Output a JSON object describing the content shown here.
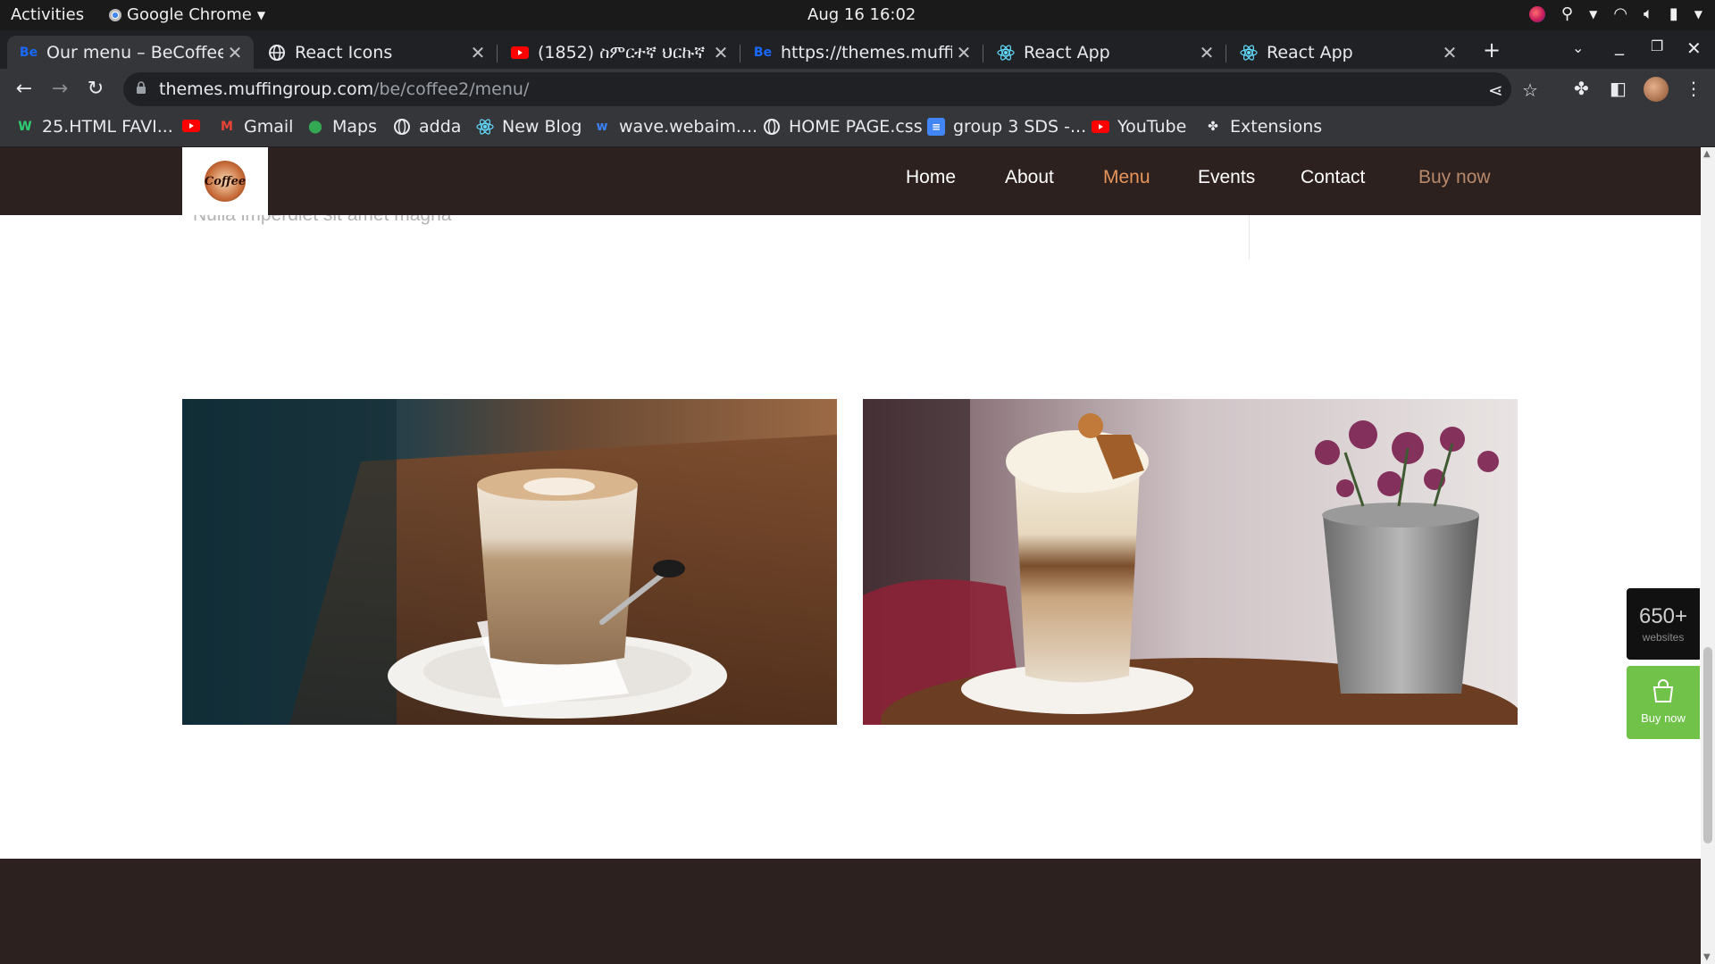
{
  "os_bar": {
    "activities": "Activities",
    "app_name": "Google Chrome",
    "clock": "Aug 16  16:02"
  },
  "tabs": [
    {
      "label": "Our menu – BeCoffee",
      "favicon": "Be",
      "active": true
    },
    {
      "label": "React Icons",
      "favicon": "globe-icon"
    },
    {
      "label": "(1852) ስምርተኛ ህርኩኛ",
      "favicon": "youtube-icon"
    },
    {
      "label": "https://themes.muffin",
      "favicon": "Be"
    },
    {
      "label": "React App",
      "favicon": "react-icon"
    },
    {
      "label": "React App",
      "favicon": "react-icon"
    }
  ],
  "toolbar": {
    "url_host": "themes.muffingroup.com",
    "url_path": "/be/coffee2/menu/"
  },
  "bookmarks": [
    {
      "label": "25.HTML FAVI...",
      "icon": "w-icon"
    },
    {
      "label": "",
      "icon": "youtube-icon"
    },
    {
      "label": "Gmail",
      "icon": "gmail-icon"
    },
    {
      "label": "Maps",
      "icon": "maps-icon"
    },
    {
      "label": "adda",
      "icon": "globe-icon"
    },
    {
      "label": "New Blog",
      "icon": "react-icon"
    },
    {
      "label": "wave.webaim....",
      "icon": "wave-icon"
    },
    {
      "label": "HOME PAGE.css",
      "icon": "globe-icon"
    },
    {
      "label": "group 3 SDS -...",
      "icon": "docs-icon"
    },
    {
      "label": "YouTube",
      "icon": "youtube-icon"
    },
    {
      "label": "Extensions",
      "icon": "puzzle-icon"
    }
  ],
  "site": {
    "logo_text": "Coffee",
    "nav": {
      "home": "Home",
      "about": "About",
      "menu": "Menu",
      "events": "Events",
      "contact": "Contact",
      "buy": "Buy now"
    },
    "partial_text": "Nulla imperdiet sit amet magna",
    "side_badge": {
      "big": "650+",
      "small": "websites"
    },
    "side_buy": "Buy now"
  },
  "colors": {
    "header_bg": "#2c211e",
    "nav_active": "#e8955a",
    "buy_green": "#71c248"
  }
}
